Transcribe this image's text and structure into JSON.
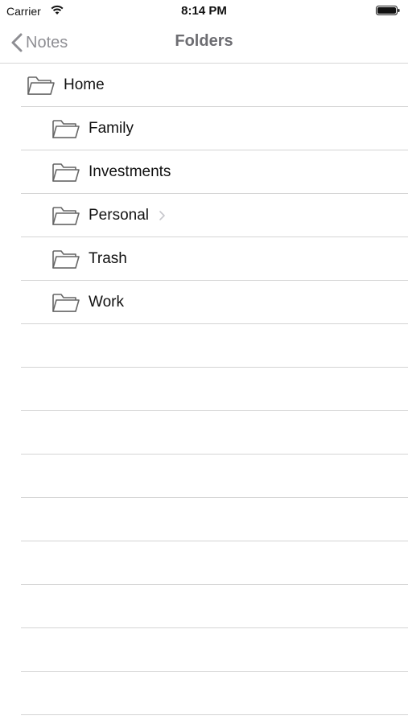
{
  "status_bar": {
    "carrier": "Carrier",
    "time": "8:14 PM"
  },
  "nav": {
    "back_label": "Notes",
    "title": "Folders"
  },
  "folders": {
    "home": "Home",
    "children": [
      "Family",
      "Investments",
      "Personal",
      "Trash",
      "Work"
    ]
  },
  "colors": {
    "nav_title": "#6d6d72",
    "back_label": "#8e8e93",
    "separator": "#d4d4d4"
  },
  "icons": {
    "folder": "folder-icon",
    "back": "chevron-left-icon",
    "disclosure": "chevron-right-icon"
  }
}
